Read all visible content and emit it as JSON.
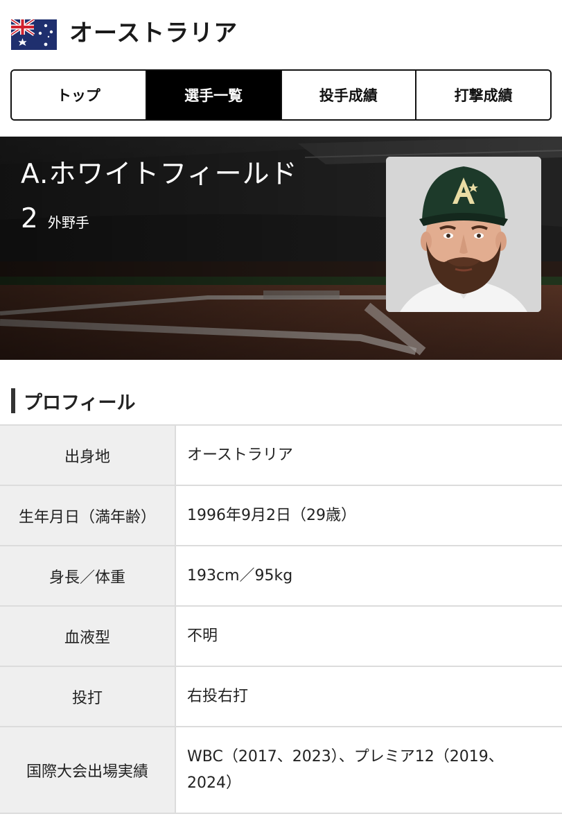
{
  "header": {
    "team_name": "オーストラリア",
    "flag_icon": "australia-flag-icon"
  },
  "tabs": [
    {
      "label": "トップ",
      "active": false
    },
    {
      "label": "選手一覧",
      "active": true
    },
    {
      "label": "投手成績",
      "active": false
    },
    {
      "label": "打撃成績",
      "active": false
    }
  ],
  "player": {
    "name": "A.ホワイトフィールド",
    "number": "2",
    "position": "外野手",
    "photo_icon": "player-photo"
  },
  "profile": {
    "section_title": "プロフィール",
    "rows": [
      {
        "label": "出身地",
        "value": "オーストラリア"
      },
      {
        "label": "生年月日（満年齢）",
        "value": "1996年9月2日（29歳）"
      },
      {
        "label": "身長／体重",
        "value": "193cm／95kg"
      },
      {
        "label": "血液型",
        "value": "不明"
      },
      {
        "label": "投打",
        "value": "右投右打"
      },
      {
        "label": "国際大会出場実績",
        "value": "WBC（2017、2023）、プレミア12（2019、2024）"
      }
    ]
  },
  "colors": {
    "tab_active_bg": "#000000",
    "table_label_bg": "#efefef",
    "table_border": "#dcdcdc"
  }
}
